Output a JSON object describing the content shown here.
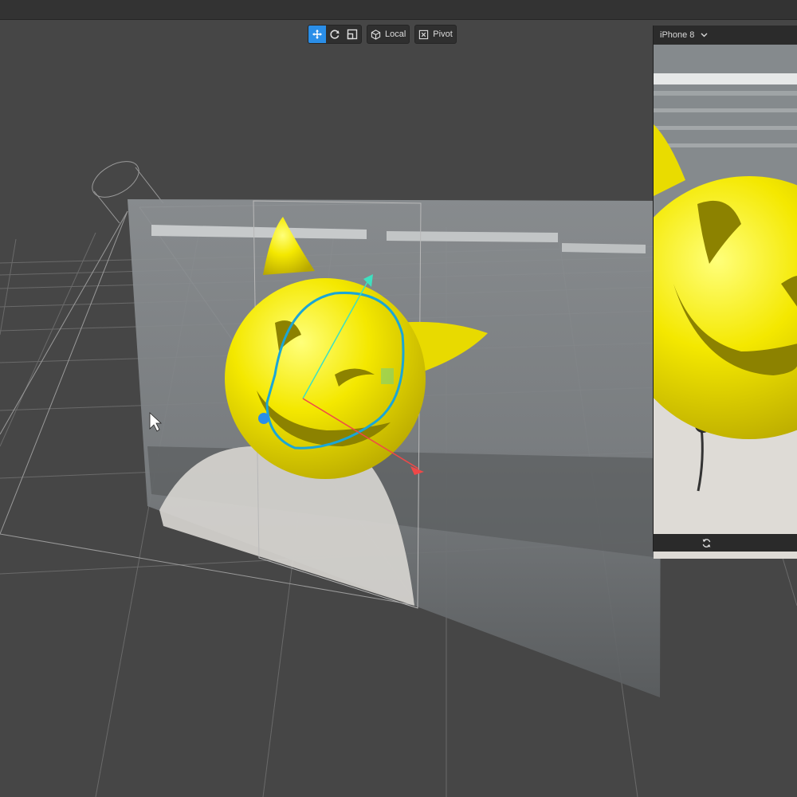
{
  "toolbar": {
    "move_tool": "move-icon",
    "rotate_tool": "rotate-icon",
    "scale_tool": "scale-icon",
    "space_label": "Local",
    "pivot_label": "Pivot"
  },
  "preview": {
    "device": "iPhone 8",
    "reload_icon": "refresh-icon"
  },
  "colors": {
    "selection": "#2a8ee8",
    "emoji": "#f2e600",
    "outline": "#1aa6d6",
    "axis_x": "#f04848",
    "axis_y": "#3ee0c0"
  }
}
